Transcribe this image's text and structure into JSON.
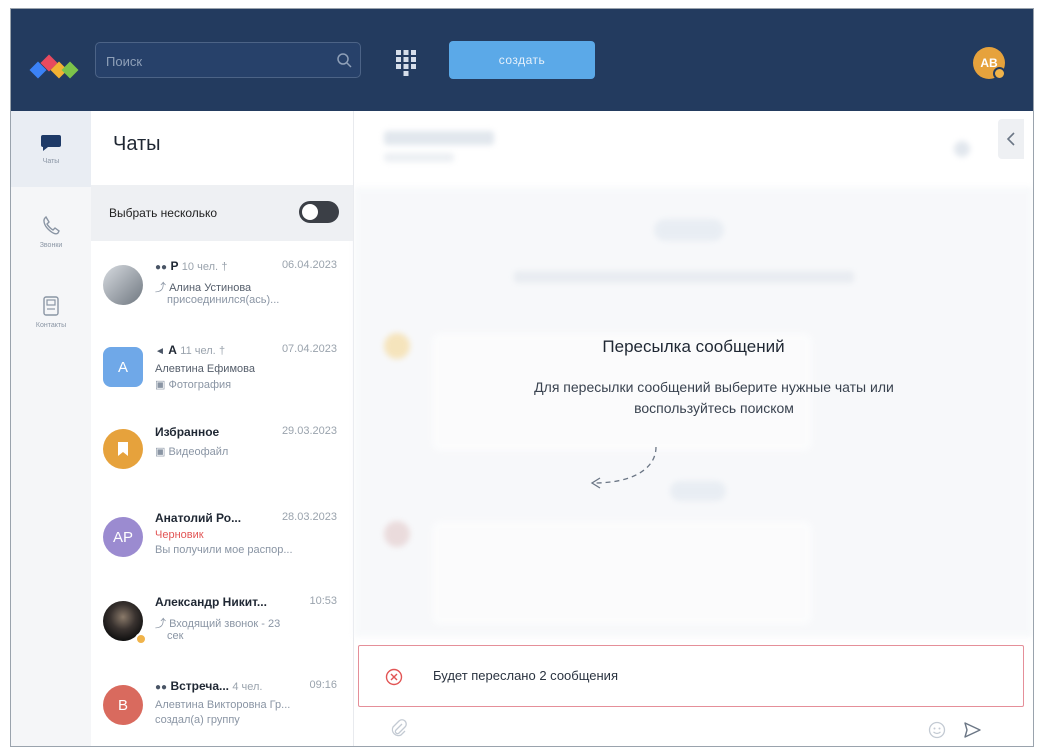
{
  "app": {
    "search_placeholder": "Поиск",
    "create_label": "создать",
    "user_initials": "AB"
  },
  "sidebar": {
    "items": [
      {
        "label": "Чаты",
        "icon": "chat-bubble-icon"
      },
      {
        "label": "Звонки",
        "icon": "phone-icon"
      },
      {
        "label": "Контакты",
        "icon": "contacts-icon"
      }
    ]
  },
  "chats": {
    "title": "Чаты",
    "select_multiple": "Выбрать несколько",
    "items": [
      {
        "name": "Р",
        "meta": "10 чел.",
        "date": "06.04.2023",
        "line2": "Алина Устинова",
        "line3": "присоединился(ась)..."
      },
      {
        "name": "А",
        "meta": "11 чел.",
        "date": "07.04.2023",
        "line2": "Алевтина Ефимова",
        "line3": "Фотография",
        "initials": "A"
      },
      {
        "name": "Избранное",
        "date": "29.03.2023",
        "line2": "Видеофайл"
      },
      {
        "name": "Анатолий Ро...",
        "date": "28.03.2023",
        "line2": "Черновик",
        "line3": "Вы получили мое распор...",
        "initials": "AP"
      },
      {
        "name": "Александр Никит...",
        "date": "10:53",
        "line2": "Входящий звонок - 23",
        "line3": "сек"
      },
      {
        "name": "Встреча...",
        "meta": "4 чел.",
        "date": "09:16",
        "line2": "Алевтина Викторовна Гр...",
        "line3": "создал(а) группу",
        "initials": "B"
      }
    ]
  },
  "forward": {
    "title": "Пересылка сообщений",
    "description": "Для пересылки сообщений выберите нужные чаты или воспользуйтесь поиском",
    "bar_text": "Будет переслано 2 сообщения"
  },
  "colors": {
    "topbar": "#233b5f",
    "accent": "#5ba9e8",
    "avatar_orange": "#e6a23c",
    "avatar_blue": "#6fa8e8",
    "avatar_purple": "#9b8bd0",
    "avatar_red": "#d96a5e",
    "forward_border": "#e58f99"
  }
}
